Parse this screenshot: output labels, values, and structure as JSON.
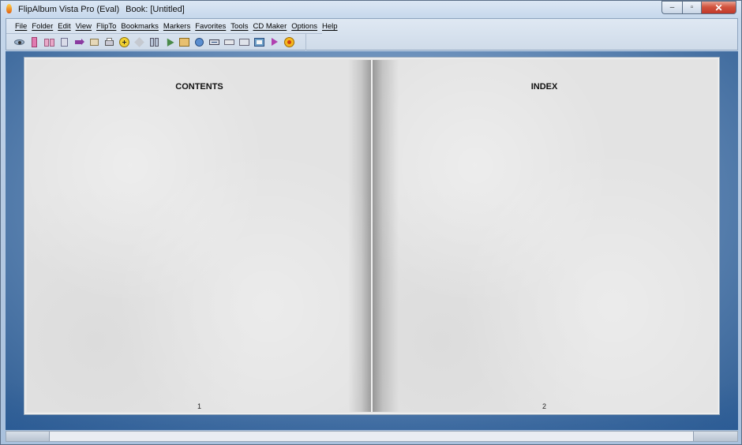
{
  "window": {
    "app_title": "FlipAlbum Vista Pro (Eval)",
    "book_title": "Book: [Untitled]",
    "controls": {
      "minimize": "–",
      "maximize": "▫",
      "close": "✕"
    }
  },
  "menu": {
    "items": [
      "File",
      "Folder",
      "Edit",
      "View",
      "FlipTo",
      "Bookmarks",
      "Markers",
      "Favorites",
      "Tools",
      "CD Maker",
      "Options",
      "Help"
    ]
  },
  "toolbar": {
    "buttons": [
      "eye-icon",
      "bookmark-icon",
      "open-book-icon",
      "page-icon",
      "flip-arrow-icon",
      "book-pages-icon",
      "print-icon",
      "add-icon",
      "rotate-icon",
      "two-page-icon",
      "cursor-icon",
      "photo-book-icon",
      "globe-icon",
      "fit-width-icon",
      "resize-icon",
      "display-icon",
      "album-icon",
      "pointer-icon",
      "star-icon"
    ]
  },
  "book": {
    "left_page": {
      "title": "CONTENTS",
      "number": "1"
    },
    "right_page": {
      "title": "INDEX",
      "number": "2"
    }
  },
  "colors": {
    "workspace_accent": "#2f5d93",
    "close_button": "#c0382a",
    "page": "#e3e3e3"
  }
}
